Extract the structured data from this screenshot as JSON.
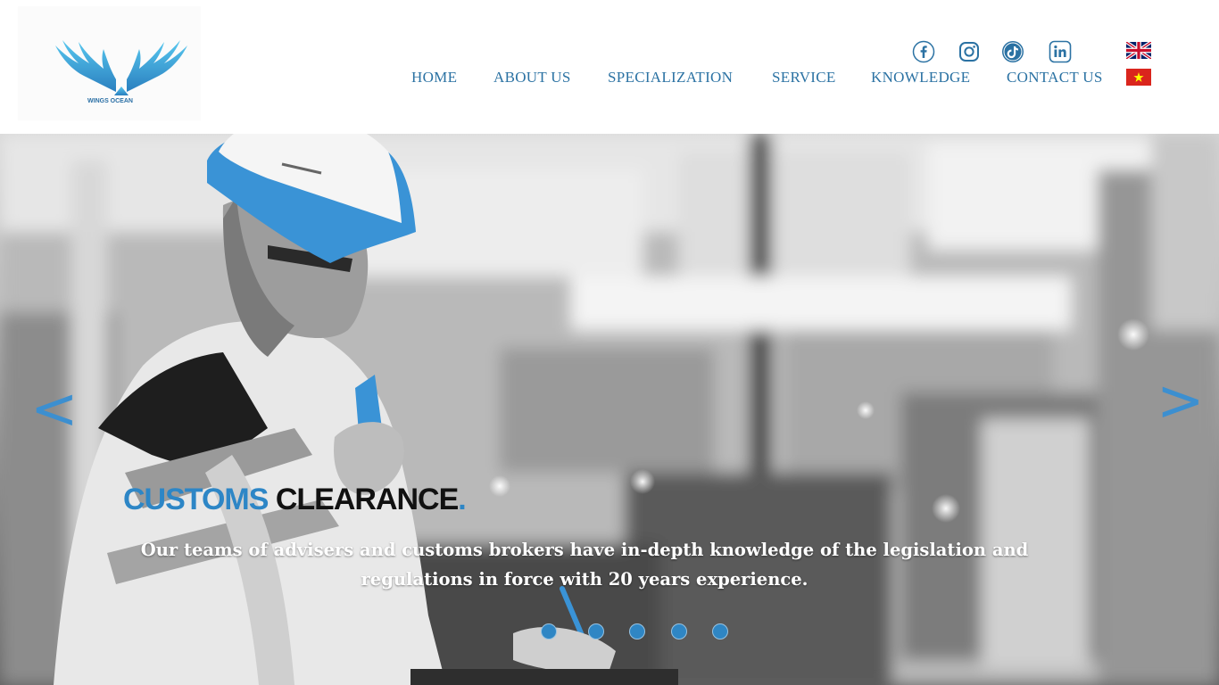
{
  "brand": {
    "logo_text": "WINGS OCEAN"
  },
  "social": [
    {
      "icon": "facebook-icon",
      "name": "Facebook"
    },
    {
      "icon": "instagram-icon",
      "name": "Instagram"
    },
    {
      "icon": "tiktok-icon",
      "name": "TikTok"
    },
    {
      "icon": "linkedin-icon",
      "name": "LinkedIn"
    }
  ],
  "languages": [
    {
      "icon": "uk-flag-icon",
      "code": "EN"
    },
    {
      "icon": "vietnam-flag-icon",
      "code": "VI"
    }
  ],
  "nav": {
    "items": [
      "HOME",
      "ABOUT US",
      "SPECIALIZATION",
      "SERVICE",
      "KNOWLEDGE",
      "CONTACT US"
    ]
  },
  "hero": {
    "title_word1": "CUSTOMS",
    "title_word2": "CLEARANCE",
    "title_dot": ".",
    "text": "Our teams of advisers and customs brokers have in-depth knowledge of the legislation and regulations in force with 20 years experience.",
    "prev_arrow": "<",
    "next_arrow": ">",
    "slide_count": 5
  },
  "colors": {
    "accent": "#2d86c6",
    "nav": "#2b72a3",
    "helmet": "#3a93d6"
  }
}
